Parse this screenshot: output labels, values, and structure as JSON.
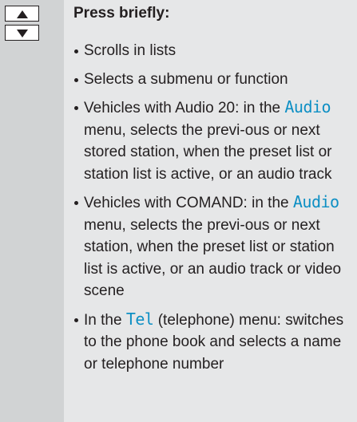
{
  "keys": {
    "up_icon": "arrow-up-icon",
    "down_icon": "arrow-down-icon"
  },
  "heading": "Press briefly:",
  "bullets": [
    {
      "text": "Scrolls in lists"
    },
    {
      "text": "Selects a submenu or function"
    },
    {
      "pre": "Vehicles with Audio 20: in the ",
      "display": "Audio",
      "post": " menu, selects the previ-ous or next stored station, when the preset list or station list is active, or an audio track"
    },
    {
      "pre": "Vehicles with COMAND: in the ",
      "display": "Audio",
      "post": " menu, selects the previ-ous or next station, when the preset list or station list is active, or an audio track or video scene"
    },
    {
      "pre": "In the ",
      "display": "Tel",
      "post": " (telephone) menu: switches to the phone book and selects a name or telephone number"
    }
  ],
  "colors": {
    "left_column": "#d1d3d4",
    "content_background": "#e6e7e8",
    "display_text": "#0d8fc4",
    "text": "#231f20"
  }
}
